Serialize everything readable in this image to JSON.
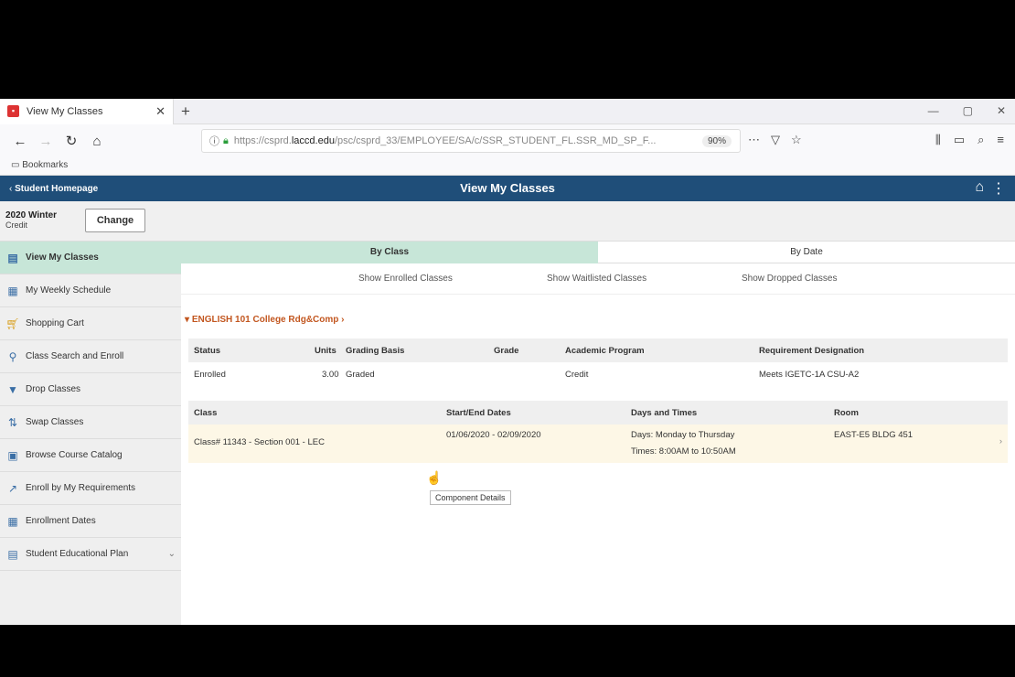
{
  "browser": {
    "tab_title": "View My Classes",
    "url_prefix": "https://csprd.",
    "url_domain": "laccd.edu",
    "url_suffix": "/psc/csprd_33/EMPLOYEE/SA/c/SSR_STUDENT_FL.SSR_MD_SP_F...",
    "zoom": "90%",
    "bookmarks_label": "Bookmarks"
  },
  "app": {
    "back_label": "Student Homepage",
    "title": "View My Classes"
  },
  "term": {
    "name": "2020 Winter",
    "career": "Credit",
    "change_label": "Change"
  },
  "sidebar": {
    "items": [
      {
        "label": "View My Classes"
      },
      {
        "label": "My Weekly Schedule"
      },
      {
        "label": "Shopping Cart"
      },
      {
        "label": "Class Search and Enroll"
      },
      {
        "label": "Drop Classes"
      },
      {
        "label": "Swap Classes"
      },
      {
        "label": "Browse Course Catalog"
      },
      {
        "label": "Enroll by My Requirements"
      },
      {
        "label": "Enrollment Dates"
      },
      {
        "label": "Student Educational Plan"
      }
    ]
  },
  "view_tabs": {
    "by_class": "By Class",
    "by_date": "By Date"
  },
  "show_links": {
    "enrolled": "Show Enrolled Classes",
    "waitlisted": "Show Waitlisted Classes",
    "dropped": "Show Dropped Classes"
  },
  "course": {
    "title": "ENGLISH 101 College Rdg&Comp"
  },
  "status_table": {
    "headers": [
      "Status",
      "Units",
      "Grading Basis",
      "Grade",
      "Academic Program",
      "Requirement Designation"
    ],
    "row": [
      "Enrolled",
      "3.00",
      "Graded",
      "",
      "Credit",
      "Meets IGETC-1A CSU-A2"
    ]
  },
  "class_table": {
    "headers": [
      "Class",
      "Start/End Dates",
      "Days and Times",
      "Room"
    ],
    "row": {
      "class": "Class# 11343 - Section 001 - LEC",
      "dates": "01/06/2020 - 02/09/2020",
      "days": "Days: Monday to Thursday",
      "times": "Times: 8:00AM to 10:50AM",
      "room": "EAST-E5 BLDG 451"
    }
  },
  "tooltip": "Component Details"
}
